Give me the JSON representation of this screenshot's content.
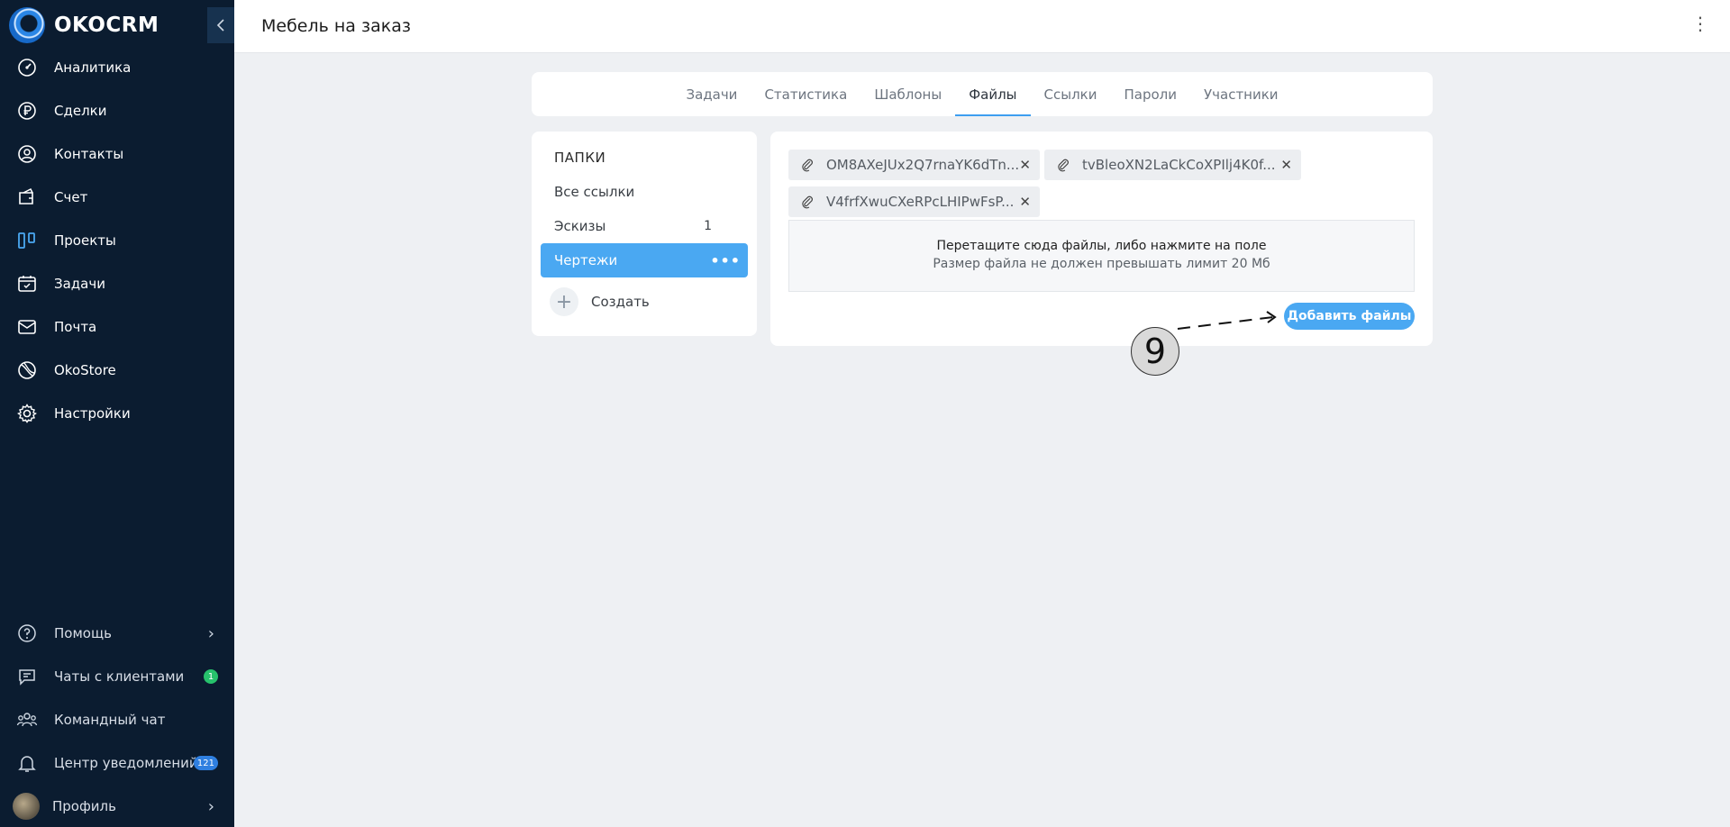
{
  "app": {
    "logo_text": "OKOCRM"
  },
  "sidebar": {
    "items": [
      {
        "label": "Аналитика",
        "icon": "gauge-icon"
      },
      {
        "label": "Сделки",
        "icon": "ruble-icon"
      },
      {
        "label": "Контакты",
        "icon": "user-circle-icon"
      },
      {
        "label": "Счет",
        "icon": "invoice-icon"
      },
      {
        "label": "Проекты",
        "icon": "kanban-icon"
      },
      {
        "label": "Задачи",
        "icon": "calendar-check-icon"
      },
      {
        "label": "Почта",
        "icon": "mail-icon"
      },
      {
        "label": "OkoStore",
        "icon": "store-icon"
      },
      {
        "label": "Настройки",
        "icon": "gear-icon"
      }
    ],
    "bottom": {
      "help": {
        "label": "Помощь",
        "icon": "help-icon"
      },
      "chats": {
        "label": "Чаты с клиентами",
        "icon": "chat-icon",
        "badge": "1"
      },
      "team_chat": {
        "label": "Командный чат",
        "icon": "team-icon"
      },
      "notifications": {
        "label": "Центр уведомлений",
        "icon": "bell-icon",
        "badge": "121"
      },
      "profile": {
        "label": "Профиль"
      }
    }
  },
  "header": {
    "title": "Мебель на заказ",
    "more": "⋮"
  },
  "tabs": [
    {
      "label": "Задачи",
      "active": false
    },
    {
      "label": "Статистика",
      "active": false
    },
    {
      "label": "Шаблоны",
      "active": false
    },
    {
      "label": "Файлы",
      "active": true
    },
    {
      "label": "Ссылки",
      "active": false
    },
    {
      "label": "Пароли",
      "active": false
    },
    {
      "label": "Участники",
      "active": false
    }
  ],
  "folders": {
    "title": "ПАПКИ",
    "items": [
      {
        "label": "Все ссылки",
        "count": ""
      },
      {
        "label": "Эскизы",
        "count": "1"
      },
      {
        "label": "Чертежи",
        "count": "",
        "active": true
      }
    ],
    "create_label": "Создать"
  },
  "files": {
    "attachments": [
      "OM8AXeJUx2Q7rnaYK6dTn...",
      "tvBleoXN2LaCkCoXPIlj4K0f...",
      "V4frfXwuCXeRPcLHIPwFsP..."
    ],
    "dropzone_line1": "Перетащите сюда файлы, либо нажмите на поле",
    "dropzone_line2": "Размер файла не должен превышать лимит 20 Мб",
    "add_button": "Добавить файлы"
  },
  "annotation": {
    "step": "9"
  },
  "colors": {
    "sidebar_bg": "#0b1c30",
    "accent": "#4aa8f2",
    "badge_green": "#27c26c",
    "badge_blue": "#2f7fe0"
  }
}
